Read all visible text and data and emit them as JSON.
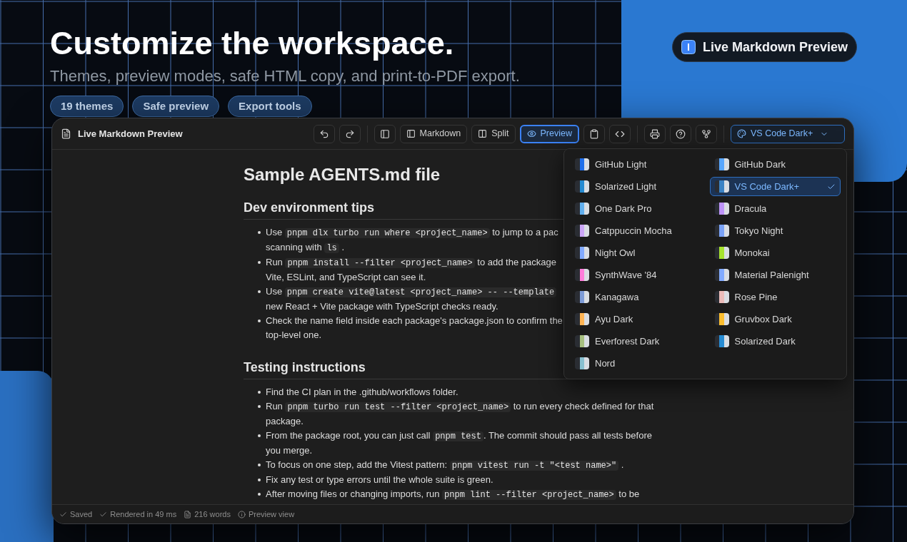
{
  "hero": {
    "title": "Customize the workspace.",
    "subtitle": "Themes, preview modes, safe HTML copy, and print-to-PDF export.",
    "pills": [
      "19 themes",
      "Safe preview",
      "Export tools"
    ],
    "badge": "Live Markdown Preview"
  },
  "window": {
    "title": "Live Markdown Preview"
  },
  "toolbar": {
    "view_modes": [
      {
        "kind": "markdown",
        "label": "Markdown",
        "selected": false
      },
      {
        "kind": "split",
        "label": "Split",
        "selected": false
      },
      {
        "kind": "preview",
        "label": "Preview",
        "selected": true
      }
    ],
    "theme_select": "VS Code Dark+"
  },
  "theme_menu": [
    {
      "name": "GitHub Light",
      "color": "#1f6feb",
      "selected": false
    },
    {
      "name": "GitHub Dark",
      "color": "#58a6ff",
      "selected": false
    },
    {
      "name": "Solarized Light",
      "color": "#268bd2",
      "selected": false
    },
    {
      "name": "VS Code Dark+",
      "color": "#3b82c4",
      "selected": true
    },
    {
      "name": "One Dark Pro",
      "color": "#61afef",
      "selected": false
    },
    {
      "name": "Dracula",
      "color": "#bd93f9",
      "selected": false
    },
    {
      "name": "Catppuccin Mocha",
      "color": "#cba6f7",
      "selected": false
    },
    {
      "name": "Tokyo Night",
      "color": "#7aa2f7",
      "selected": false
    },
    {
      "name": "Night Owl",
      "color": "#82aaff",
      "selected": false
    },
    {
      "name": "Monokai",
      "color": "#a6e22e",
      "selected": false
    },
    {
      "name": "SynthWave '84",
      "color": "#ff7edb",
      "selected": false
    },
    {
      "name": "Material Palenight",
      "color": "#82aaff",
      "selected": false
    },
    {
      "name": "Kanagawa",
      "color": "#7e9cd8",
      "selected": false
    },
    {
      "name": "Rose Pine",
      "color": "#ebbcba",
      "selected": false
    },
    {
      "name": "Ayu Dark",
      "color": "#ffb454",
      "selected": false
    },
    {
      "name": "Gruvbox Dark",
      "color": "#fabd2f",
      "selected": false
    },
    {
      "name": "Everforest Dark",
      "color": "#a7c080",
      "selected": false
    },
    {
      "name": "Solarized Dark",
      "color": "#268bd2",
      "selected": false
    },
    {
      "name": "Nord",
      "color": "#88c0d0",
      "selected": false
    }
  ],
  "document": {
    "title": "Sample AGENTS.md file",
    "sections": [
      {
        "heading": "Dev environment tips",
        "items": [
          {
            "lines": [
              [
                {
                  "text": "Use ",
                  "code": false
                },
                {
                  "text": "pnpm dlx turbo run where <project_name>",
                  "code": true
                },
                {
                  "text": " to jump to a pac",
                  "code": false
                }
              ],
              [
                {
                  "text": "scanning with ",
                  "code": false
                },
                {
                  "text": "ls",
                  "code": true
                },
                {
                  "text": " .",
                  "code": false
                }
              ]
            ]
          },
          {
            "lines": [
              [
                {
                  "text": "Run ",
                  "code": false
                },
                {
                  "text": "pnpm install --filter <project_name>",
                  "code": true
                },
                {
                  "text": " to add the package",
                  "code": false
                }
              ],
              [
                {
                  "text": "Vite, ESLint, and TypeScript can see it.",
                  "code": false
                }
              ]
            ]
          },
          {
            "lines": [
              [
                {
                  "text": "Use ",
                  "code": false
                },
                {
                  "text": "pnpm create vite@latest <project_name> -- --template",
                  "code": true
                }
              ],
              [
                {
                  "text": "new React + Vite package with TypeScript checks ready.",
                  "code": false
                }
              ]
            ]
          },
          {
            "lines": [
              [
                {
                  "text": "Check the name field inside each package's package.json to confirm the",
                  "code": false
                }
              ],
              [
                {
                  "text": "top-level one.",
                  "code": false
                }
              ]
            ]
          }
        ]
      },
      {
        "heading": "Testing instructions",
        "items": [
          {
            "lines": [
              [
                {
                  "text": "Find the CI plan in the .github/workflows folder.",
                  "code": false
                }
              ]
            ]
          },
          {
            "lines": [
              [
                {
                  "text": "Run ",
                  "code": false
                },
                {
                  "text": "pnpm turbo run test --filter <project_name>",
                  "code": true
                },
                {
                  "text": " to run every check defined for that",
                  "code": false
                }
              ],
              [
                {
                  "text": "package.",
                  "code": false
                }
              ]
            ]
          },
          {
            "lines": [
              [
                {
                  "text": "From the package root, you can just call ",
                  "code": false
                },
                {
                  "text": "pnpm test",
                  "code": true
                },
                {
                  "text": ". The commit should pass all tests before",
                  "code": false
                }
              ],
              [
                {
                  "text": "you merge.",
                  "code": false
                }
              ]
            ]
          },
          {
            "lines": [
              [
                {
                  "text": "To focus on one step, add the Vitest pattern: ",
                  "code": false
                },
                {
                  "text": "pnpm vitest run -t \"<test name>\"",
                  "code": true
                },
                {
                  "text": " .",
                  "code": false
                }
              ]
            ]
          },
          {
            "lines": [
              [
                {
                  "text": "Fix any test or type errors until the whole suite is green.",
                  "code": false
                }
              ]
            ]
          },
          {
            "lines": [
              [
                {
                  "text": "After moving files or changing imports, run ",
                  "code": false
                },
                {
                  "text": "pnpm lint --filter <project_name>",
                  "code": true
                },
                {
                  "text": " to be",
                  "code": false
                }
              ]
            ]
          }
        ]
      }
    ]
  },
  "status_bar": [
    {
      "kind": "check",
      "label": "Saved"
    },
    {
      "kind": "check",
      "label": "Rendered in 49 ms"
    },
    {
      "kind": "words",
      "label": "216 words"
    },
    {
      "kind": "info",
      "label": "Preview view"
    }
  ]
}
